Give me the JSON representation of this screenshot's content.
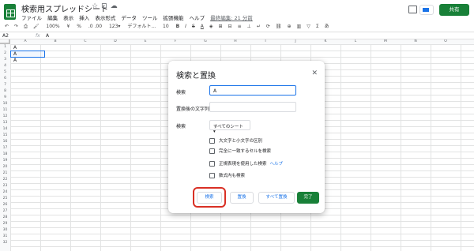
{
  "doc_title": "検索用スプレッドシート",
  "menu": [
    "ファイル",
    "編集",
    "表示",
    "挿入",
    "表示形式",
    "データ",
    "ツール",
    "拡張機能",
    "ヘルプ"
  ],
  "last_edit": "最終編集: 21 分前",
  "share_label": "共有",
  "toolbar": {
    "zoom": "100%",
    "currency": "¥",
    "percent": "%",
    "decimals": ".0  .00",
    "format": "123▾",
    "font": "デフォルト...",
    "font_size": "10"
  },
  "formula_bar": {
    "cell_ref": "A2",
    "fx": "fx",
    "value": "A"
  },
  "grid": {
    "columns": [
      "A",
      "B",
      "C",
      "D",
      "E",
      "F",
      "G",
      "H",
      "I",
      "J",
      "K",
      "L",
      "M",
      "N",
      "O"
    ],
    "rows": [
      "1",
      "2",
      "3",
      "4",
      "5",
      "6",
      "7",
      "8",
      "9",
      "10",
      "11",
      "12",
      "13",
      "14",
      "15",
      "16",
      "17",
      "18",
      "19",
      "20",
      "21",
      "22",
      "23",
      "24",
      "25",
      "26",
      "27",
      "28",
      "29",
      "30",
      "31",
      "32"
    ],
    "cells": [
      "A",
      "A",
      "A"
    ]
  },
  "dialog": {
    "title": "検索と置換",
    "find_label": "検索",
    "find_value": "A",
    "replace_label": "置換後の文字列",
    "replace_value": "",
    "search_label": "検索",
    "search_scope": "すべてのシート ▾",
    "options": [
      "大文字と小文字の区別",
      "完全に一致するセルを検索",
      "正規表現を使用した検索",
      "数式内も検索"
    ],
    "help_link": "ヘルプ",
    "buttons": {
      "find": "検索",
      "replace": "置換",
      "replace_all": "すべて置換",
      "done": "完了"
    }
  },
  "colors": {
    "accent": "#1a73e8",
    "brand": "#188038",
    "highlight": "#d93025"
  }
}
